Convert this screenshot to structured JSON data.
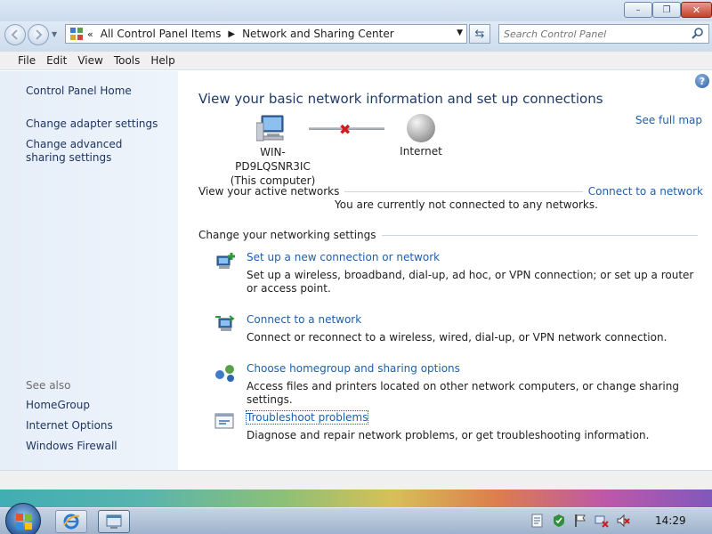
{
  "window": {
    "controls": {
      "minimize": "–",
      "maximize": "❐",
      "close": "✕"
    }
  },
  "nav": {
    "breadcrumb": [
      "All Control Panel Items",
      "Network and Sharing Center"
    ],
    "search_placeholder": "Search Control Panel"
  },
  "menu": [
    "File",
    "Edit",
    "View",
    "Tools",
    "Help"
  ],
  "sidebar": {
    "items": [
      "Control Panel Home",
      "Change adapter settings",
      "Change advanced sharing settings"
    ],
    "see_also_label": "See also",
    "see_also": [
      "HomeGroup",
      "Internet Options",
      "Windows Firewall"
    ]
  },
  "main": {
    "title": "View your basic network information and set up connections",
    "see_full_map": "See full map",
    "computer_name": "WIN-PD9LQSNR3IC",
    "computer_sub": "(This computer)",
    "internet_label": "Internet",
    "active_networks_label": "View your active networks",
    "connect_to_network": "Connect to a network",
    "not_connected": "You are currently not connected to any networks.",
    "change_settings_label": "Change your networking settings",
    "tasks": [
      {
        "link": "Set up a new connection or network",
        "desc": "Set up a wireless, broadband, dial-up, ad hoc, or VPN connection; or set up a router or access point."
      },
      {
        "link": "Connect to a network",
        "desc": "Connect or reconnect to a wireless, wired, dial-up, or VPN network connection."
      },
      {
        "link": "Choose homegroup and sharing options",
        "desc": "Access files and printers located on other network computers, or change sharing settings."
      },
      {
        "link": "Troubleshoot problems",
        "desc": "Diagnose and repair network problems, or get troubleshooting information."
      }
    ]
  },
  "taskbar": {
    "clock": "14:29"
  },
  "icons": {
    "help": "help-icon",
    "search": "search-icon",
    "refresh": "refresh-icon"
  }
}
